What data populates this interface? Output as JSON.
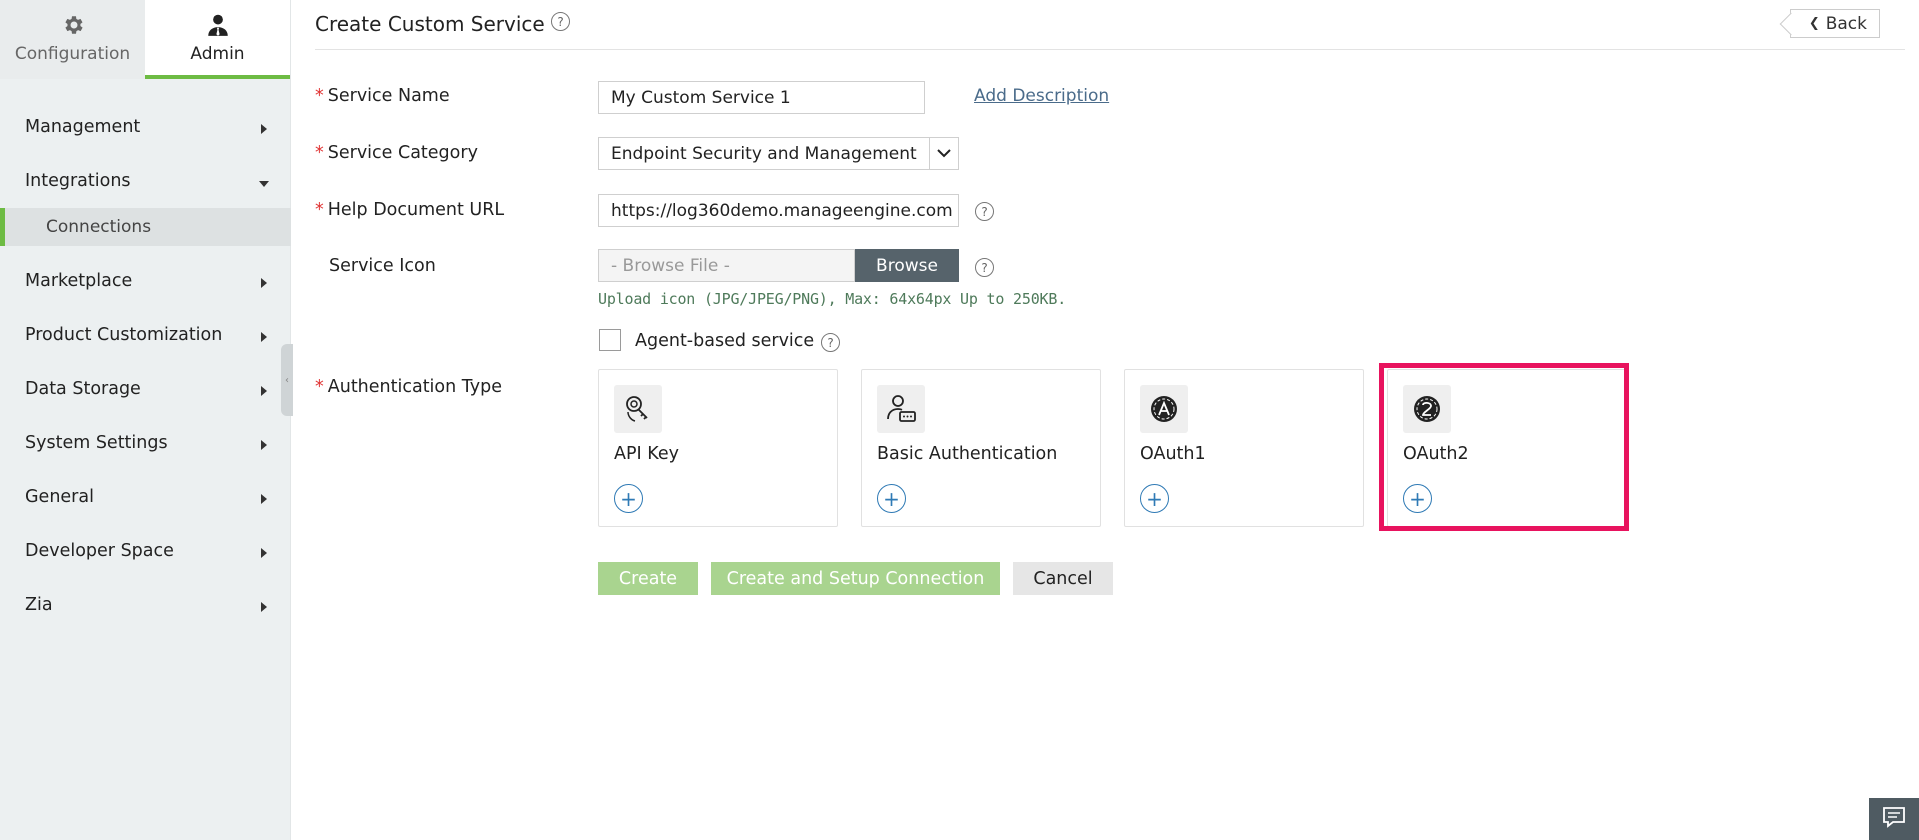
{
  "sidebar": {
    "tabs": [
      {
        "label": "Configuration",
        "icon": "gear-icon"
      },
      {
        "label": "Admin",
        "icon": "user-icon"
      }
    ],
    "items": [
      {
        "label": "Management"
      },
      {
        "label": "Integrations"
      },
      {
        "label": "Marketplace"
      },
      {
        "label": "Product Customization"
      },
      {
        "label": "Data Storage"
      },
      {
        "label": "System Settings"
      },
      {
        "label": "General"
      },
      {
        "label": "Developer Space"
      },
      {
        "label": "Zia"
      }
    ],
    "sub_item": {
      "label": "Connections"
    }
  },
  "header": {
    "title": "Create Custom Service",
    "help": "?",
    "back_label": "Back"
  },
  "form": {
    "service_name": {
      "label": "Service Name",
      "value": "My Custom Service 1",
      "link": "Add Description"
    },
    "service_category": {
      "label": "Service Category",
      "value": "Endpoint Security and Management"
    },
    "help_url": {
      "label": "Help Document URL",
      "value": "https://log360demo.manageengine.com"
    },
    "service_icon": {
      "label": "Service Icon",
      "placeholder": "- Browse File -",
      "browse_label": "Browse",
      "hint": "Upload icon (JPG/JPEG/PNG), Max: 64x64px Up to 250KB."
    },
    "agent_based": {
      "label": "Agent-based service",
      "checked": false
    },
    "auth_type": {
      "label": "Authentication Type",
      "options": [
        {
          "label": "API Key",
          "icon": "api-key-icon"
        },
        {
          "label": "Basic Authentication",
          "icon": "basic-auth-icon"
        },
        {
          "label": "OAuth1",
          "icon": "oauth1-icon"
        },
        {
          "label": "OAuth2",
          "icon": "oauth2-icon",
          "highlighted": true
        }
      ]
    }
  },
  "actions": {
    "create": "Create",
    "create_setup": "Create and Setup Connection",
    "cancel": "Cancel"
  },
  "colors": {
    "accent_green": "#6dbb43",
    "button_green": "#a9d48f",
    "highlight": "#e8135e",
    "link_blue": "#2f7ab5",
    "browse_dark": "#56636b"
  }
}
